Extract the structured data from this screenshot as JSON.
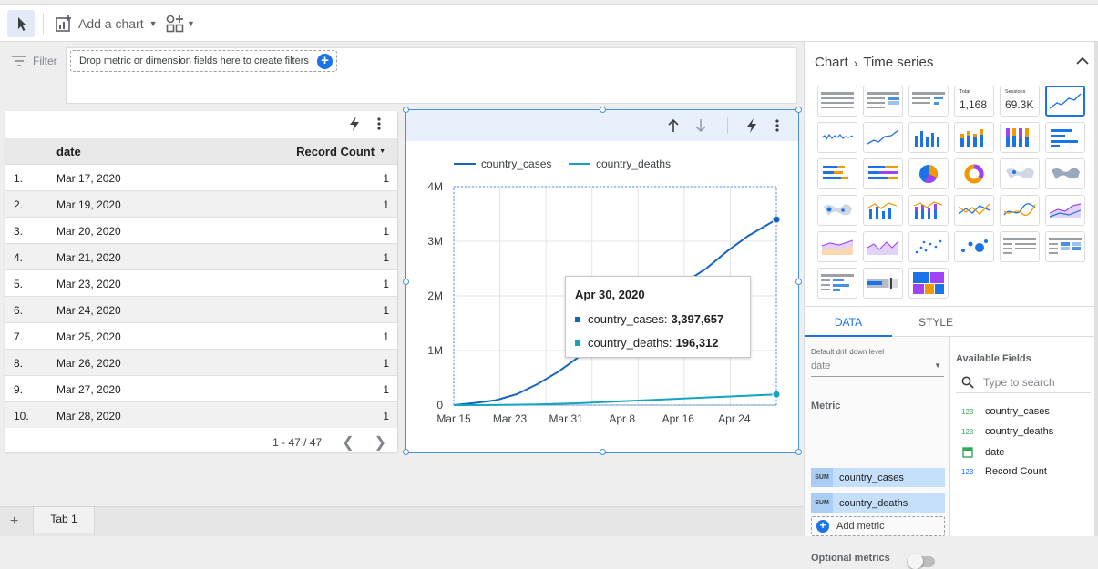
{
  "toolbar": {
    "add_chart_label": "Add a chart"
  },
  "filter": {
    "label": "Filter",
    "dropzone_text": "Drop metric or dimension fields here to create filters"
  },
  "table": {
    "columns": {
      "date": "date",
      "count": "Record Count"
    },
    "rows": [
      {
        "n": "1.",
        "date": "Mar 17, 2020",
        "value": "1"
      },
      {
        "n": "2.",
        "date": "Mar 19, 2020",
        "value": "1"
      },
      {
        "n": "3.",
        "date": "Mar 20, 2020",
        "value": "1"
      },
      {
        "n": "4.",
        "date": "Mar 21, 2020",
        "value": "1"
      },
      {
        "n": "5.",
        "date": "Mar 23, 2020",
        "value": "1"
      },
      {
        "n": "6.",
        "date": "Mar 24, 2020",
        "value": "1"
      },
      {
        "n": "7.",
        "date": "Mar 25, 2020",
        "value": "1"
      },
      {
        "n": "8.",
        "date": "Mar 26, 2020",
        "value": "1"
      },
      {
        "n": "9.",
        "date": "Mar 27, 2020",
        "value": "1"
      },
      {
        "n": "10.",
        "date": "Mar 28, 2020",
        "value": "1"
      }
    ],
    "pagination": "1 - 47 / 47"
  },
  "chart_data": {
    "type": "line",
    "x_ticks": [
      "Mar 15",
      "Mar 23",
      "Mar 31",
      "Apr 8",
      "Apr 16",
      "Apr 24"
    ],
    "x_range": [
      "2020-03-15",
      "2020-04-30"
    ],
    "y_ticks": [
      "0",
      "1M",
      "2M",
      "3M",
      "4M"
    ],
    "ylim": [
      0,
      4000000
    ],
    "legend_position": "top",
    "grid": true,
    "series": [
      {
        "name": "country_cases",
        "color": "#1565c0",
        "x": [
          "2020-03-15",
          "2020-03-18",
          "2020-03-21",
          "2020-03-24",
          "2020-03-27",
          "2020-03-30",
          "2020-04-02",
          "2020-04-05",
          "2020-04-08",
          "2020-04-11",
          "2020-04-14",
          "2020-04-17",
          "2020-04-20",
          "2020-04-23",
          "2020-04-26",
          "2020-04-30"
        ],
        "values": [
          0,
          40000,
          90000,
          200000,
          390000,
          620000,
          900000,
          1220000,
          1520000,
          1750000,
          2000000,
          2250000,
          2500000,
          2820000,
          3100000,
          3397657
        ]
      },
      {
        "name": "country_deaths",
        "color": "#12a4c4",
        "x": [
          "2020-03-15",
          "2020-03-21",
          "2020-03-27",
          "2020-04-02",
          "2020-04-08",
          "2020-04-14",
          "2020-04-20",
          "2020-04-26",
          "2020-04-30"
        ],
        "values": [
          0,
          3000,
          12000,
          35000,
          70000,
          105000,
          140000,
          172000,
          196312
        ]
      }
    ],
    "tooltip": {
      "title": "Apr 30, 2020",
      "lines": [
        {
          "label": "country_cases:",
          "value": "3,397,657",
          "color": "#1565c0"
        },
        {
          "label": "country_deaths:",
          "value": "196,312",
          "color": "#12a4c4"
        }
      ]
    }
  },
  "panel": {
    "crumb_root": "Chart",
    "crumb_leaf": "Time series",
    "scorecard_total_label": "Total",
    "scorecard_total_value": "1,168",
    "scorecard_sessions_label": "Sessions",
    "scorecard_sessions_value": "69.3K",
    "tabs": {
      "data": "DATA",
      "style": "STYLE"
    },
    "drill_label": "Default drill down level",
    "drill_value": "date",
    "metric_label": "Metric",
    "metrics": [
      {
        "agg": "SUM",
        "name": "country_cases"
      },
      {
        "agg": "SUM",
        "name": "country_deaths"
      }
    ],
    "add_metric": "Add metric",
    "optional_metrics": "Optional metrics",
    "available_fields_label": "Available Fields",
    "search_placeholder": "Type to search",
    "fields": [
      {
        "type": "123",
        "name": "country_cases"
      },
      {
        "type": "123",
        "name": "country_deaths"
      },
      {
        "type": "calendar",
        "name": "date"
      },
      {
        "type": "123",
        "name": "Record Count"
      }
    ]
  },
  "page_tabs": {
    "tab1": "Tab 1"
  }
}
